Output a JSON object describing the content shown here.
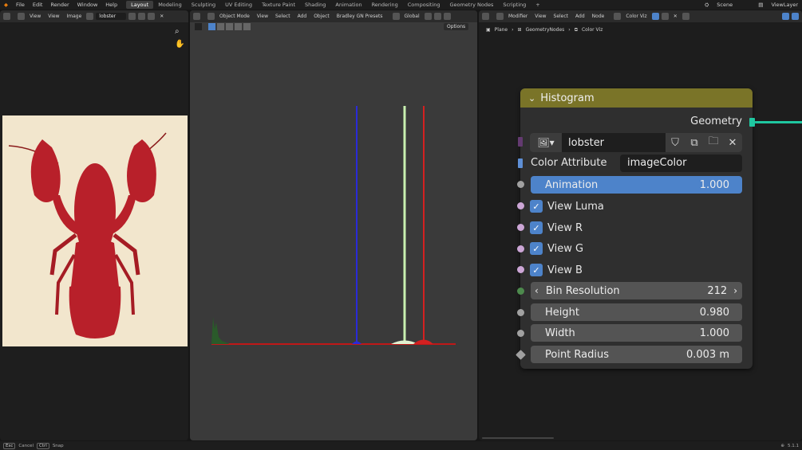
{
  "topbar": {
    "menus": [
      "File",
      "Edit",
      "Render",
      "Window",
      "Help"
    ],
    "workspaces": [
      "Layout",
      "Modeling",
      "Sculpting",
      "UV Editing",
      "Texture Paint",
      "Shading",
      "Animation",
      "Rendering",
      "Compositing",
      "Geometry Nodes",
      "Scripting"
    ],
    "active_workspace": "Layout",
    "add_tab": "+",
    "scene": "Scene",
    "view_layer": "ViewLayer"
  },
  "image_editor": {
    "view_label": "View",
    "menus": [
      "View",
      "Image"
    ],
    "image_name": "lobster"
  },
  "viewport": {
    "mode": "Object Mode",
    "menus": [
      "View",
      "Select",
      "Add",
      "Object",
      "Bradley GN Presets"
    ],
    "orientation": "Global",
    "options": "Options",
    "histogram_colors": {
      "blue": "#2a2ad8",
      "green": "#b8f0a0",
      "red": "#d42020"
    }
  },
  "node_editor": {
    "modifier_label": "Modifier",
    "menus": [
      "View",
      "Select",
      "Add",
      "Node"
    ],
    "tree_name": "Color Viz",
    "breadcrumb": [
      "Plane",
      "GeometryNodes",
      "Color Viz"
    ]
  },
  "node": {
    "title": "Histogram",
    "output_label": "Geometry",
    "image_name": "lobster",
    "color_attribute": {
      "label": "Color Attribute",
      "value": "imageColor"
    },
    "animation": {
      "label": "Animation",
      "value": "1.000"
    },
    "checkboxes": [
      {
        "label": "View Luma"
      },
      {
        "label": "View R"
      },
      {
        "label": "View G"
      },
      {
        "label": "View B"
      }
    ],
    "bin_resolution": {
      "label": "Bin Resolution",
      "value": "212"
    },
    "height": {
      "label": "Height",
      "value": "0.980"
    },
    "width": {
      "label": "Width",
      "value": "1.000"
    },
    "point_radius": {
      "label": "Point Radius",
      "value": "0.003 m"
    },
    "header_color": "#7a7428",
    "accent": "#4d83ca"
  },
  "statusbar": {
    "cancel_key": "Esc",
    "cancel_label": "Cancel",
    "snap_key": "Ctrl",
    "snap_label": "Snap",
    "version": "5.1.1"
  }
}
